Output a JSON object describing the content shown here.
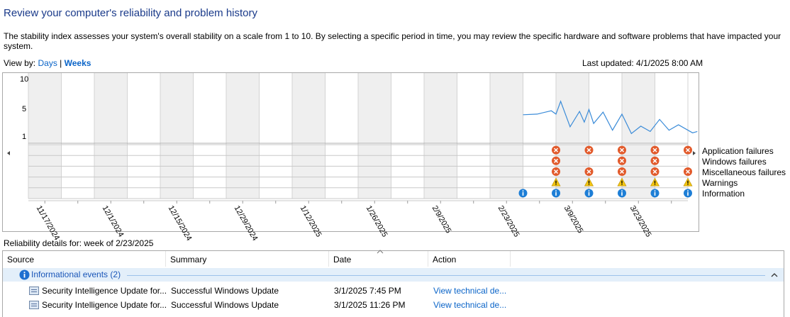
{
  "header": {
    "title": "Review your computer's reliability and problem history",
    "description": "The stability index assesses your system's overall stability on a scale from 1 to 10. By selecting a specific period in time, you may review the specific hardware and software problems that have impacted your system.",
    "view_by_label": "View by:",
    "days_label": "Days",
    "separator": "|",
    "weeks_label": "Weeks",
    "last_updated": "Last updated: 4/1/2025 8:00 AM"
  },
  "chart": {
    "y_ticks": [
      "10",
      "5",
      "1"
    ],
    "dates": [
      "11/17/2024",
      "12/1/2024",
      "12/15/2024",
      "12/29/2024",
      "1/12/2025",
      "1/26/2025",
      "2/9/2025",
      "2/23/2025",
      "3/9/2025",
      "3/23/2025"
    ],
    "row_labels": [
      "Application failures",
      "Windows failures",
      "Miscellaneous failures",
      "Warnings",
      "Information"
    ],
    "selected_week": "2/23/2025",
    "colors": {
      "stability_line": "#3a8bd8",
      "selected": "#c4ddf4",
      "shaded": "#efefef",
      "error": "#e25a2b",
      "warning": "#f3c612",
      "info": "#1d7ed6"
    }
  },
  "chart_data": {
    "type": "line",
    "title": "",
    "ylabel": "",
    "ylim": [
      1,
      10
    ],
    "x": [
      "2/23/2025",
      "2/26/2025",
      "3/1/2025",
      "3/2/2025",
      "3/3/2025",
      "3/5/2025",
      "3/7/2025",
      "3/8/2025",
      "3/9/2025",
      "3/10/2025",
      "3/12/2025",
      "3/14/2025",
      "3/16/2025",
      "3/18/2025",
      "3/20/2025",
      "3/22/2025",
      "3/24/2025",
      "3/26/2025",
      "3/28/2025",
      "3/31/2025",
      "4/1/2025"
    ],
    "series": [
      {
        "values": [
          4.3,
          4.4,
          4.9,
          4.4,
          6.3,
          2.5,
          4.8,
          3.2,
          5.1,
          3.0,
          4.7,
          2.0,
          4.4,
          1.5,
          2.6,
          1.8,
          3.6,
          2.0,
          2.8,
          1.6,
          1.8
        ]
      }
    ],
    "events": {
      "application_failures": [
        "3/2/2025",
        "3/9/2025",
        "3/16/2025",
        "3/23/2025",
        "3/30/2025"
      ],
      "windows_failures": [
        "3/2/2025",
        "3/16/2025",
        "3/23/2025"
      ],
      "miscellaneous_failures": [
        "3/2/2025",
        "3/9/2025",
        "3/16/2025",
        "3/23/2025",
        "3/30/2025"
      ],
      "warnings": [
        "3/2/2025",
        "3/9/2025",
        "3/16/2025",
        "3/23/2025",
        "3/30/2025"
      ],
      "information": [
        "2/23/2025",
        "3/2/2025",
        "3/9/2025",
        "3/16/2025",
        "3/23/2025",
        "3/30/2025"
      ]
    }
  },
  "details": {
    "label": "Reliability details for: week of 2/23/2025",
    "columns": [
      "Source",
      "Summary",
      "Date",
      "Action"
    ],
    "group": "Informational events (2)",
    "rows": [
      {
        "source": "Security Intelligence Update for...",
        "summary": "Successful Windows Update",
        "date": "3/1/2025 7:45 PM",
        "action": "View technical de..."
      },
      {
        "source": "Security Intelligence Update for...",
        "summary": "Successful Windows Update",
        "date": "3/1/2025 11:26 PM",
        "action": "View technical de..."
      }
    ]
  }
}
